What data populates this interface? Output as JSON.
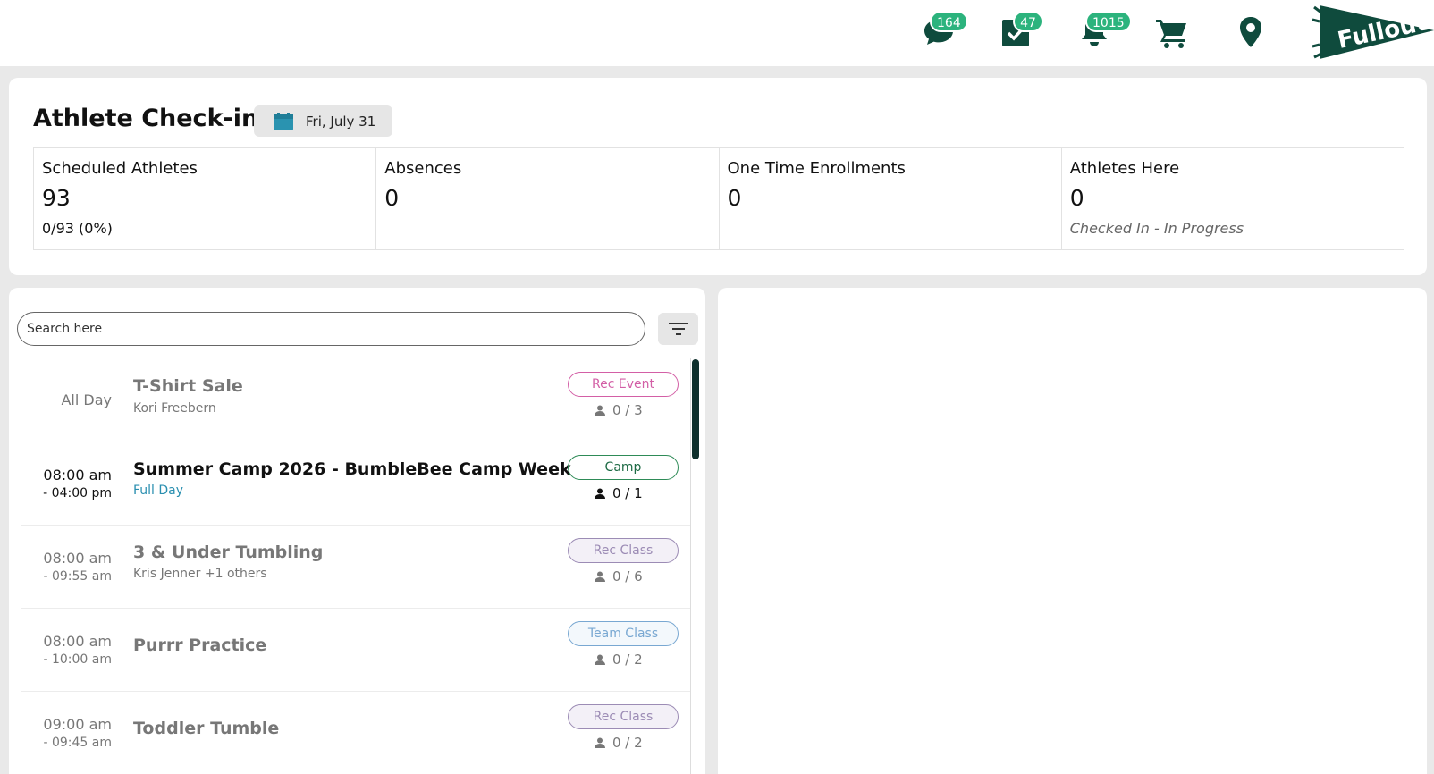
{
  "colors": {
    "brand": "#0f4b3d",
    "badge": "#2cb37d",
    "camp": "#2e8b57",
    "rec_event": "#d35fa6",
    "rec_class": "#9c8cb5",
    "team_class": "#79a8d2"
  },
  "header": {
    "messages_badge": "164",
    "tasks_badge": "47",
    "notifications_badge": "1015",
    "icons": [
      "chat-icon",
      "checkbox-icon",
      "bell-icon",
      "cart-icon",
      "location-pin-icon"
    ]
  },
  "summary": {
    "title": "Athlete Check-in",
    "date": "Fri, July 31",
    "stats": [
      {
        "label": "Scheduled Athletes",
        "value": "93",
        "sub": "0/93 (0%)"
      },
      {
        "label": "Absences",
        "value": "0",
        "sub": ""
      },
      {
        "label": "One Time Enrollments",
        "value": "0",
        "sub": ""
      },
      {
        "label": "Athletes Here",
        "value": "0",
        "sub": "Checked In - In Progress"
      }
    ]
  },
  "search": {
    "placeholder": "Search here",
    "value": ""
  },
  "events": [
    {
      "time": "All Day",
      "title": "T-Shirt Sale",
      "subtitle": "Kori Freebern",
      "tag": "Rec Event",
      "count": "0 / 3"
    },
    {
      "start": "08:00 am",
      "end": "- 04:00 pm",
      "title": "Summer Camp 2026 - BumbleBee Camp Week",
      "subtitle": "Full Day",
      "tag": "Camp",
      "count": "0 / 1"
    },
    {
      "start": "08:00 am",
      "end": "- 09:55 am",
      "title": "3 & Under Tumbling",
      "subtitle": "Kris Jenner +1 others",
      "tag": "Rec Class",
      "count": "0 / 6"
    },
    {
      "start": "08:00 am",
      "end": "- 10:00 am",
      "title": "Purrr Practice",
      "subtitle": "",
      "tag": "Team Class",
      "count": "0 / 2"
    },
    {
      "start": "09:00 am",
      "end": "- 09:45 am",
      "title": "Toddler Tumble",
      "subtitle": "",
      "tag": "Rec Class",
      "count": "0 / 2"
    }
  ]
}
